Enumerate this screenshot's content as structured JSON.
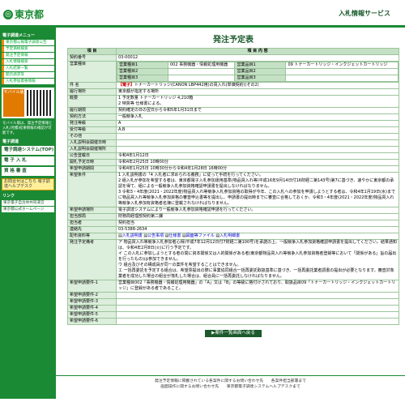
{
  "header": {
    "logo": "東京都",
    "service": "入札情報サービス"
  },
  "sidebar": {
    "section1": "電子調達メニュー",
    "items": [
      "東京都公報電子調達公告",
      "予定価格検索",
      "発注予定情報",
      "入札情報検索",
      "入札結果一覧",
      "開示請求等",
      "入札参加資格情報"
    ],
    "mobile_btn": "モバイル版",
    "mobile_text": "モバイル版は、発注予定情報と入札(見積)結果情報の確認が可能です。",
    "section2": "電子調達",
    "big_buttons": [
      "電子調達システム(TOP)",
      "電 子 入 札",
      "資 格 審 査"
    ],
    "inquiry": "お問合せはこちら 電子調達ヘルプデスク",
    "section3": "リンク",
    "links": [
      "東京電子自治体共同運営",
      "東京都公式ホームページ"
    ]
  },
  "main": {
    "title": "発注予定表",
    "header": {
      "item": "項 目",
      "content": "項 目 内 容"
    },
    "contract_no": {
      "label": "契約番号",
      "value": "03-00012"
    },
    "business": {
      "label": "営業種目",
      "rows": [
        {
          "k1": "営業種目1",
          "v1": "002 事務機器・情報処理用機器",
          "k2": "営業品目1",
          "v2": "09 トナーカートリッジ・インクジェットカートリッジ"
        },
        {
          "k1": "営業種目2",
          "v1": "",
          "k2": "営業品目2",
          "v2": ""
        },
        {
          "k1": "営業種目3",
          "v1": "",
          "k2": "営業品目3",
          "v2": ""
        }
      ]
    },
    "subject": {
      "label": "件 名",
      "tag": "【電子】",
      "value": "トナーカートリッジ(CANON LBP442用)の買入れ(単価契約)(その2)"
    },
    "delivery": {
      "label": "履行場所",
      "value": "東京都が指定する場所"
    },
    "summary": {
      "label": "概要",
      "line1": "1 予定数量 トナーカートリッジ 4,210箱",
      "line2": "2 特質等 仕様書による。"
    },
    "period": {
      "label": "履行期限",
      "value": "契約確定の日の翌日から令和5年1月31日まで"
    },
    "method": {
      "label": "契約方法",
      "value": "一般競争入札"
    },
    "ptype": {
      "label": "発注等級",
      "value": "A"
    },
    "grade": {
      "label": "受付等級",
      "value": "A,B"
    },
    "other": {
      "label": "その他",
      "value": ""
    },
    "briefing_date": {
      "label": "入札説明会開催日時",
      "value": ""
    },
    "briefing_place": {
      "label": "入札説明会開催場所",
      "value": ""
    },
    "pub_date": {
      "label": "公告登載日",
      "value": "令和4年1月12日"
    },
    "open_date": {
      "label": "開札予定日時",
      "value": "令和4年2月25日 10時00分"
    },
    "apply": {
      "label": "希望申請期間",
      "value": "令和4年1月25日 10時30分から令和4年1月28日 16時00分"
    },
    "notes": {
      "label": "希望条件",
      "lines": [
        "1 入札説明書の「4 入札者に求められる義務」に従って手続を行ってください。",
        "2 組入札が参加を希望する者は、東京都電子入札参加運用基準(物品買入れ等)平成16年9月14日付16財経二第143号)第7に基づき、速やかに東京都の承認を得て、組による一般競争入札参加資格確認申請書を提出しなければなりません。",
        "3 令和3・4年度(2021・2022年度)物品買入れ等競争入札参加資格の取得が今年、この入札への参加を申請しようとする者は、令和4年1月19日(水)までに物品買入れ等競争入札参加資格の審査申込書等を提出し、申請書の提出時までに審査に合格しておくか、令和3・4年度(2021・2022年度)物品買入れ等競争入札参加有資格者名簿に登載されなければなりません。"
      ]
    },
    "apply_place": {
      "label": "希望申請場所",
      "value": "電子調達システムにより一般競争入札参加資格確認申請を行ってください。"
    },
    "dept": {
      "label": "担当部局",
      "value": "財務局経理部契約第二課"
    },
    "person": {
      "label": "担当者",
      "value": "契約担当"
    },
    "tel": {
      "label": "連絡先",
      "value": "03-5388-2634"
    },
    "docs": {
      "label": "配布資料等",
      "files": [
        "入札説明書",
        "公告事項",
        "仕様書",
        "図面等ファイル",
        "入札明細書"
      ]
    },
    "remarks": {
      "label": "発注予定備考",
      "lines": [
        "ア 物品買入れ等競争入札参加者心得(平成7年12月12日付7財経二第100号)を承諾の上、一般競争入札参加資格確認申請書を提出してください。結果通知は、令和4年2月8日(火)に行う予定です。",
        "イ この入札に参加しようとする者の間に資本関係又は人的関係がある者(東京都物品買入れ等競争入札参加資格者登録等において「関係がある」旨の届出を行ったもの)は参加できません。",
        "ウ 組合及びその構成員が同一の案件を希望することはできません。",
        "エ 一括再委託を予定する組合は、希望票提出の際に事業協同組合一括再委託取扱基準に基づき、一括再委託業者調書の提出が必要となります。審査対象業者を成功した場合の組合が落札した場合は、組合員に一括再委託しなければなりません。"
      ]
    },
    "cond1": {
      "label": "希望申請要件-1",
      "value": "営業種目002「事務機器・情報処理用機器」の「A」又は「B」の等級に格付けされており、取扱品目09「トナーカートリッジ・インクジェットカートリッジ」に登録がある者であること。"
    },
    "cond_labels": [
      "希望申請要件-2",
      "希望申請要件-3",
      "希望申請要件-4",
      "希望申請要件-5",
      "希望申請要件-6"
    ],
    "back": "▶案件一覧画面へ戻る"
  },
  "footer": {
    "line1": "発注予定情報に掲載されている各案件に関するお問い合わせ先　　各案件担当部署まで",
    "line2": "画面操作に関するお問い合わせ先　　東京都電子調達システムヘルプデスクまで"
  }
}
